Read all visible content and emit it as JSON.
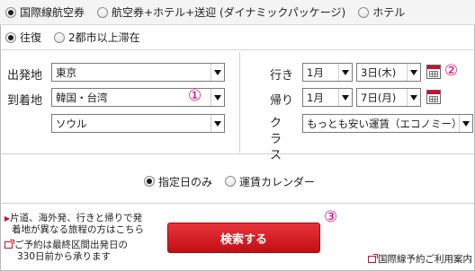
{
  "trip_type": {
    "options": [
      "国際線航空券",
      "航空券+ホテル+送迎 (ダイナミックパッケージ)",
      "ホテル"
    ],
    "selected": 0
  },
  "route_type": {
    "options": [
      "往復",
      "2都市以上滞在"
    ],
    "selected": 0
  },
  "departure": {
    "label": "出発地",
    "value": "東京"
  },
  "arrival": {
    "label": "到着地",
    "region": "韓国・台湾",
    "city": "ソウル"
  },
  "outbound": {
    "label": "行き",
    "month": "1月",
    "day": "3日(木)"
  },
  "return": {
    "label": "帰り",
    "month": "1月",
    "day": "7日(月)"
  },
  "class": {
    "label": "クラス",
    "value": "もっとも安い運賃（エコノミー）"
  },
  "date_mode": {
    "options": [
      "指定日のみ",
      "運賃カレンダー"
    ],
    "selected": 0
  },
  "notes": {
    "oneway_line1": "片道、海外発、行きと帰りで発",
    "oneway_line2": "着地が異なる旅程の方はこちら",
    "advance_line1": "ご予約は最終区間出発日の",
    "advance_line2": "330日前から承ります"
  },
  "search_label": "検索する",
  "guide_link": "国際線予約ご利用案内",
  "markers": {
    "m1": "①",
    "m2": "②",
    "m3": "③"
  },
  "colors": {
    "accent_red": "#c8102e",
    "marker_pink": "#e6006f"
  }
}
